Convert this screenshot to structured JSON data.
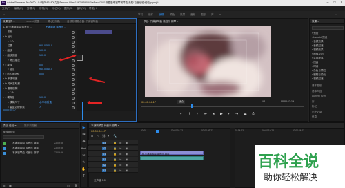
{
  "window": {
    "title": "Adobe Premiere Pro 2020 - C:\\用户\\86180\\文档\\Tencent Files\\1667585809\\FileRecv\\2021新春晨曦钢琴钢琴曲\\未知\\百度经验\\经验.prproj *",
    "logo": "Pr"
  },
  "menu": [
    "文件(F)",
    "编辑(E)",
    "剪辑(C)",
    "序列(S)",
    "标记(M)",
    "图形(G)",
    "窗口(W)",
    "帮助(H)"
  ],
  "workspaces": [
    "学习",
    "组件",
    "编辑",
    "颜色",
    "效果",
    "音频",
    "图形",
    "库",
    "»"
  ],
  "effect_controls": {
    "tabs": [
      "效果控件 ≡",
      "Lumetri 范围",
      "源:(无剪辑)",
      "音频剪辑混合器: 不满钢琴曲"
    ],
    "source": "主要*不满钢琴曲 纯音乐 ...",
    "sequence": "不满钢琴 纯音乐 ...",
    "rows": [
      {
        "k": "视频",
        "v": ""
      },
      {
        "k": "› fx 运动",
        "v": ""
      },
      {
        "k": "○ □ ✎",
        "v": ""
      },
      {
        "k": "位置",
        "v": "960.0   540.0"
      },
      {
        "k": "› ○ 缩放",
        "v": "100.0"
      },
      {
        "k": "› ○ 缩放宽度",
        "v": "100.0"
      },
      {
        "k": "✓ 等比缩放",
        "v": ""
      },
      {
        "k": "› ○ 旋转",
        "v": "0.0"
      },
      {
        "k": "○ 锚点",
        "v": "960.0   540.0"
      },
      {
        "k": "› ○ 防闪烁滤镜",
        "v": "0.00"
      },
      {
        "k": "› fx 不透明度",
        "v": ""
      },
      {
        "k": "› fx 时间重映射",
        "v": ""
      },
      {
        "k": "› fx 高斯模糊",
        "v": ""
      },
      {
        "k": "○ □ ✎",
        "v": ""
      },
      {
        "k": "› ○ 模糊度",
        "v": "100.0"
      },
      {
        "k": "○ 模糊尺寸",
        "v": "水平和垂直"
      },
      {
        "k": "○ 重复边缘像素",
        "v": "✓"
      }
    ],
    "timecode": "00:00:04:17"
  },
  "program": {
    "title": "节目: 不满钢琴曲 纯音乐 钢琴 ≡",
    "timecode_left": "00:00:04:17",
    "fit": "适合",
    "quality": "1/2",
    "timecode_right": "00:00:13:19"
  },
  "effects": {
    "tab": "效果 ≡",
    "items": [
      "› 预设",
      "› Lumetri 预设",
      "› 音频效果",
      "› 音频过渡",
      "› 视频效果",
      "  › 图像控制",
      "  › 实用程序",
      "  › 扭曲",
      "  › 时间",
      "  › 杂色与颗粒",
      "  › 模糊与锐化",
      "› 视频过渡"
    ],
    "bottom": [
      "基本图形",
      "基本声音",
      "Lumetri 颜色",
      "库",
      "标记",
      "历史记录",
      "信息"
    ]
  },
  "project": {
    "tabs": [
      "项目: 经验 ≡",
      "媒体浏览器"
    ],
    "file": "经验.prproj",
    "items": [
      {
        "name": "不满钢琴曲 纯音乐 钢琴",
        "dur": "23:09:56"
      },
      {
        "name": "不满钢琴曲 纯音乐 钢琴",
        "dur": "23:09:56"
      },
      {
        "name": "不满钢琴曲 纯音乐 钢琴",
        "dur": "23:09:56"
      }
    ]
  },
  "timeline": {
    "tab": "不满钢琴曲 纯音乐 钢琴 ≡",
    "timecode": "00:00:04:17",
    "ruler": [
      "00:00",
      "00:00:04:23",
      "00:00:09:23",
      "00:00:14:23",
      "00:00:19:23",
      "00:00:24:23"
    ],
    "tracks": [
      "V3",
      "V2",
      "V1",
      "A1",
      "A2",
      "A3"
    ],
    "clip_video": "fx 不满钢琴曲 纯音乐 钢琴",
    "master": "主声道 0.0"
  },
  "tools": [
    "▶",
    "⇆",
    "✥",
    "⟷",
    "✂",
    "✎",
    "✋",
    "T"
  ],
  "watermark": {
    "line1": "百科全说",
    "line2": "助你轻松解决"
  }
}
